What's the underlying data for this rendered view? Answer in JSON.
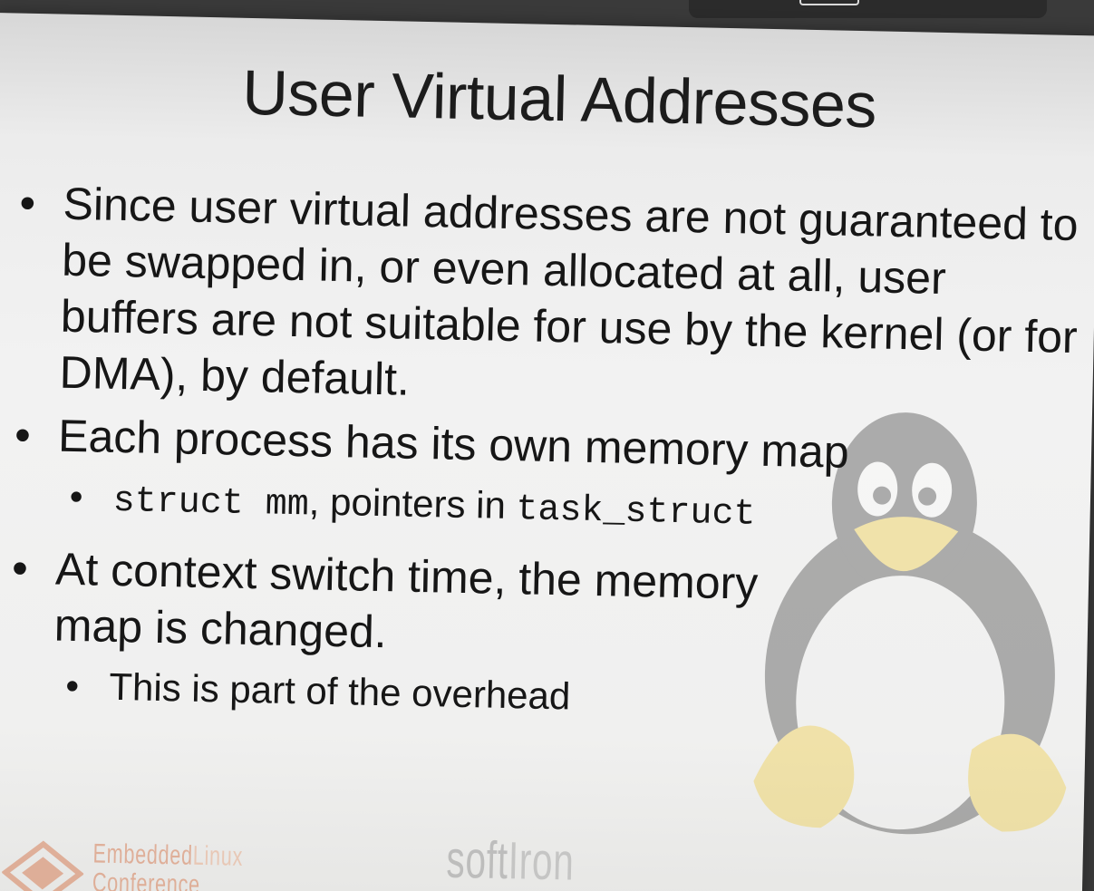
{
  "slide": {
    "title": "User Virtual Addresses",
    "bullets": [
      {
        "text": "Since user virtual addresses are not guaranteed to be swapped in, or even allocated at all, user buffers are not suitable for use by the kernel (or for DMA), by default."
      },
      {
        "text": "Each process has its own memory map",
        "sub": {
          "code1": "struct mm",
          "middle": ", pointers in ",
          "code2": "task_struct"
        }
      },
      {
        "text": "At context switch time, the memory map is changed.",
        "sub": {
          "text": "This is part of the overhead"
        }
      }
    ]
  },
  "logos": {
    "elc_line1": "Embedded",
    "elc_line1b": "Linux",
    "elc_line2": "Conference",
    "softiron_a": "soft",
    "softiron_b": "Iron"
  },
  "bullet_glyph": "•",
  "colors": {
    "elc_orange": "#d46a3b",
    "penguin_yellow": "#f0c419"
  },
  "icons": [
    "tux-penguin-icon",
    "elc-logo-icon"
  ]
}
